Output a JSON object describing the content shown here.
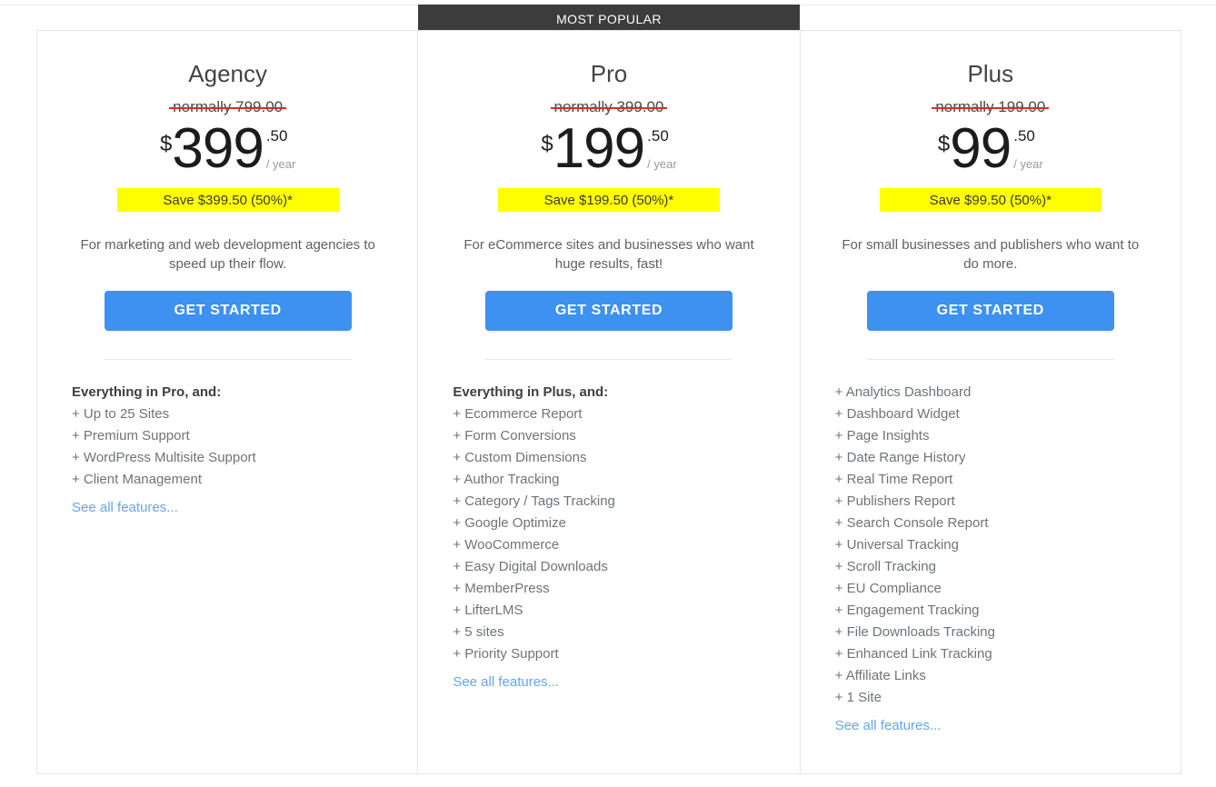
{
  "banner": {
    "label": "MOST POPULAR"
  },
  "plans": [
    {
      "name": "Agency",
      "normally": "normally 799.00",
      "currency": "$",
      "price": "399",
      "cents": ".50",
      "period": "/ year",
      "save": "Save $399.50 (50%)*",
      "description": "For marketing and web development agencies to speed up their flow.",
      "cta": "GET STARTED",
      "features_intro": "Everything in Pro, and:",
      "features": [
        "+ Up to 25 Sites",
        "+ Premium Support",
        "+ WordPress Multisite Support",
        "+ Client Management"
      ],
      "see_all": "See all features..."
    },
    {
      "name": "Pro",
      "normally": "normally 399.00",
      "currency": "$",
      "price": "199",
      "cents": ".50",
      "period": "/ year",
      "save": "Save $199.50 (50%)*",
      "description": "For eCommerce sites and businesses who want huge results, fast!",
      "cta": "GET STARTED",
      "features_intro": "Everything in Plus, and:",
      "features": [
        "+ Ecommerce Report",
        "+ Form Conversions",
        "+ Custom Dimensions",
        "+ Author Tracking",
        "+ Category / Tags Tracking",
        "+ Google Optimize",
        "+ WooCommerce",
        "+ Easy Digital Downloads",
        "+ MemberPress",
        "+ LifterLMS",
        "+ 5 sites",
        "+ Priority Support"
      ],
      "see_all": "See all features..."
    },
    {
      "name": "Plus",
      "normally": "normally 199.00",
      "currency": "$",
      "price": "99",
      "cents": ".50",
      "period": "/ year",
      "save": "Save $99.50 (50%)*",
      "description": "For small businesses and publishers who want to do more.",
      "cta": "GET STARTED",
      "features_intro": "",
      "features": [
        "+ Analytics Dashboard",
        "+ Dashboard Widget",
        "+ Page Insights",
        "+ Date Range History",
        "+ Real Time Report",
        "+ Publishers Report",
        "+ Search Console Report",
        "+ Universal Tracking",
        "+ Scroll Tracking",
        "+ EU Compliance",
        "+ Engagement Tracking",
        "+ File Downloads Tracking",
        "+ Enhanced Link Tracking",
        "+ Affiliate Links",
        "+ 1 Site"
      ],
      "see_all": "See all features..."
    }
  ],
  "colors": {
    "cta": "#3d91f0",
    "banner": "#3c3c3c",
    "save_highlight": "#ffff00",
    "strike": "#e02b20",
    "link": "#66a6e8"
  }
}
